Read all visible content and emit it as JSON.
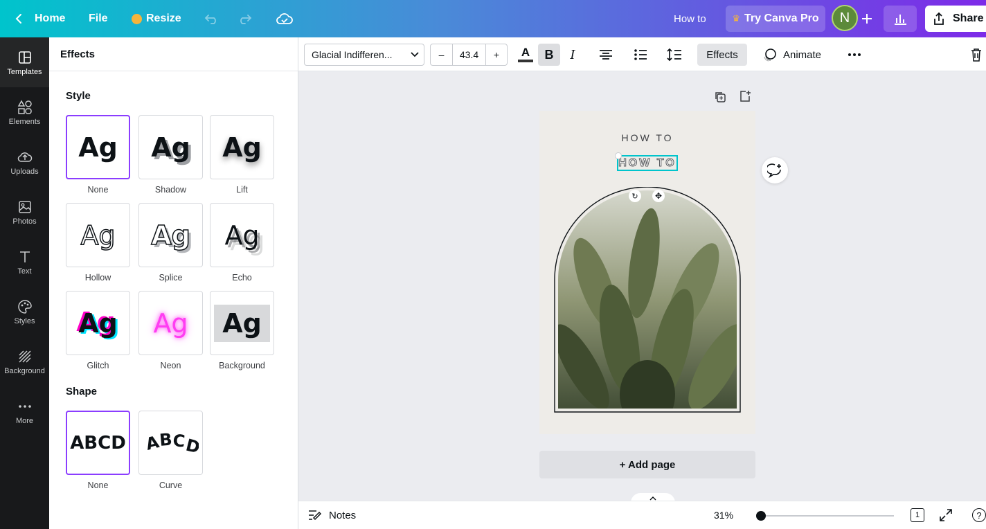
{
  "topbar": {
    "home_label": "Home",
    "file_label": "File",
    "resize_label": "Resize",
    "doc_title": "How to",
    "try_pro_label": "Try Canva Pro",
    "avatar_initial": "N",
    "share_label": "Share"
  },
  "sidebar": {
    "items": [
      {
        "label": "Templates",
        "icon": "templates-icon"
      },
      {
        "label": "Elements",
        "icon": "elements-icon"
      },
      {
        "label": "Uploads",
        "icon": "uploads-icon"
      },
      {
        "label": "Photos",
        "icon": "photos-icon"
      },
      {
        "label": "Text",
        "icon": "text-icon"
      },
      {
        "label": "Styles",
        "icon": "styles-icon"
      },
      {
        "label": "Background",
        "icon": "background-icon"
      },
      {
        "label": "More",
        "icon": "more-icon"
      }
    ]
  },
  "panel": {
    "title": "Effects",
    "style_title": "Style",
    "style_sample": "Ag",
    "styles": [
      {
        "label": "None",
        "selected": true
      },
      {
        "label": "Shadow"
      },
      {
        "label": "Lift"
      },
      {
        "label": "Hollow"
      },
      {
        "label": "Splice"
      },
      {
        "label": "Echo"
      },
      {
        "label": "Glitch"
      },
      {
        "label": "Neon"
      },
      {
        "label": "Background"
      }
    ],
    "shape_title": "Shape",
    "shape_sample": "ABCD",
    "shapes": [
      {
        "label": "None",
        "selected": true
      },
      {
        "label": "Curve"
      }
    ]
  },
  "toolbar": {
    "font_name": "Glacial Indifferen...",
    "minus": "–",
    "font_size": "43.4",
    "plus": "+",
    "text_color_glyph": "A",
    "bold_glyph": "B",
    "italic_glyph": "I",
    "effects_label": "Effects",
    "animate_label": "Animate"
  },
  "canvas": {
    "text_top": "HOW TO",
    "text_selected": "HOW TO",
    "add_page_label": "+ Add page"
  },
  "bottombar": {
    "notes_label": "Notes",
    "zoom": "31%",
    "page_count": "1",
    "help": "?"
  },
  "colors": {
    "accent": "#8b3dff",
    "selection": "#00c4cc",
    "sidebar_bg": "#18191b"
  }
}
